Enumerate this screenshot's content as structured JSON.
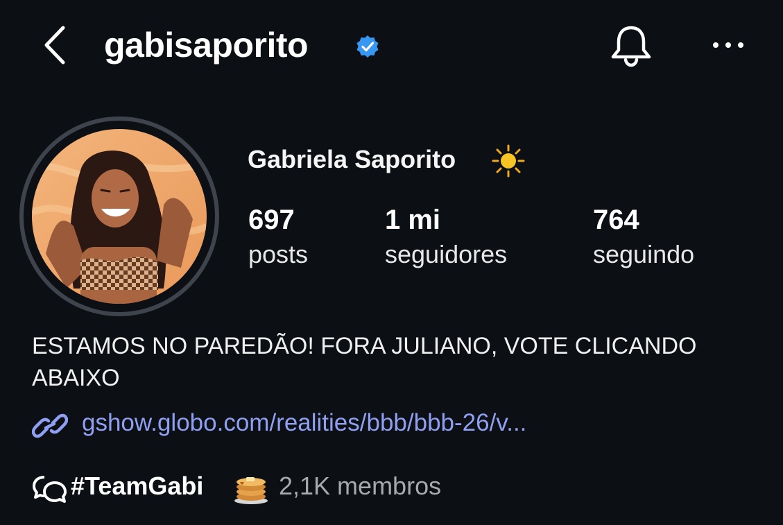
{
  "header": {
    "username": "gabisaporito",
    "verified_icon": "verified-badge-icon",
    "back_icon": "chevron-left-icon",
    "bell_icon": "bell-icon",
    "more_icon": "ellipsis-icon"
  },
  "profile": {
    "display_name": "Gabriela Saporito",
    "name_emoji": "sun-emoji",
    "avatar": "profile-photo"
  },
  "stats": [
    {
      "value": "697",
      "label": "posts"
    },
    {
      "value": "1 mi",
      "label": "seguidores"
    },
    {
      "value": "764",
      "label": "seguindo"
    }
  ],
  "bio": {
    "text": "ESTAMOS NO PAREDÃO! FORA JULIANO, VOTE CLICANDO ABAIXO"
  },
  "link": {
    "icon": "link-icon",
    "url_text": "gshow.globo.com/realities/bbb/bbb-26/v..."
  },
  "channel": {
    "icon": "chat-bubbles-icon",
    "name": "#TeamGabi",
    "emoji": "pancakes-emoji",
    "members": "2,1K membros"
  },
  "colors": {
    "background": "#0c0f14",
    "link": "#8fa0f3",
    "verified": "#3897f0",
    "muted_text": "#a7a9ae"
  }
}
